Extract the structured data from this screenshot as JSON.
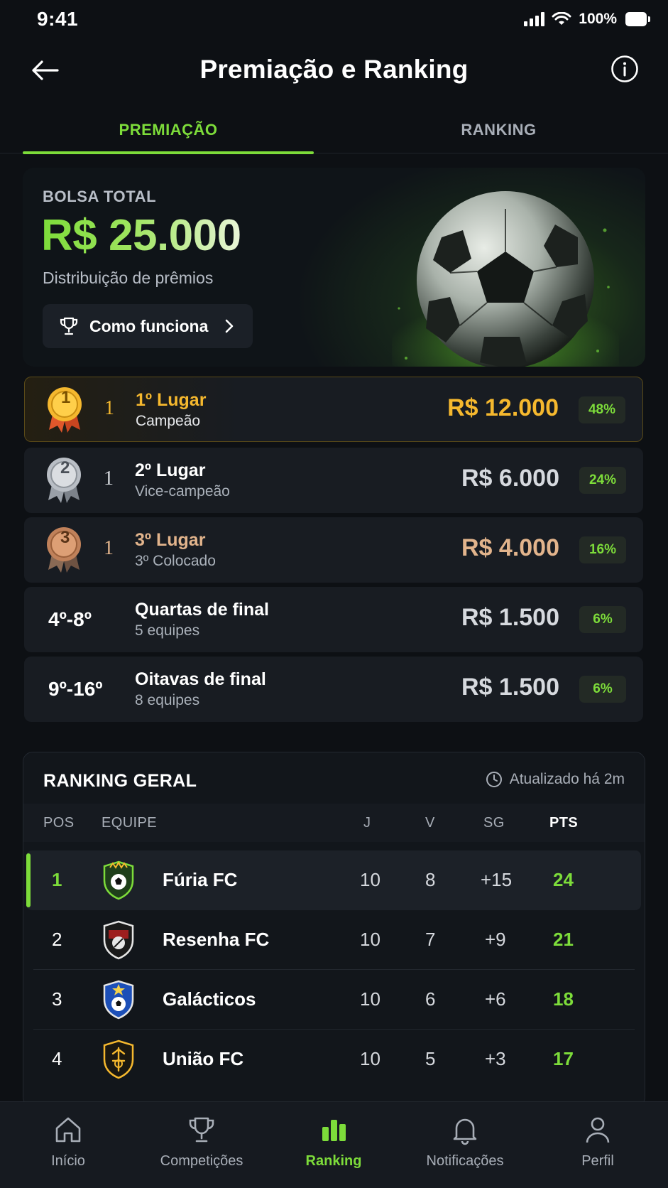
{
  "status_bar": {
    "time": "9:41",
    "battery": "100%"
  },
  "header": {
    "title": "Premiação e Ranking"
  },
  "tabs": [
    {
      "label": "PREMIAÇÃO"
    },
    {
      "label": "RANKING"
    }
  ],
  "hero": {
    "label": "BOLSA TOTAL",
    "amount": "R$ 25.000",
    "subtitle": "Distribuição de prêmios",
    "button_label": "Como funciona"
  },
  "prizes": [
    {
      "medal": "1",
      "side": "1",
      "name": "1º Lugar",
      "desc": "Campeão",
      "amount": "R$ 12.000",
      "pct": "48%",
      "color": "#f5b82e"
    },
    {
      "medal": "2",
      "side": "1",
      "name": "2º Lugar",
      "desc": "Vice-campeão",
      "amount": "R$ 6.000",
      "pct": "24%",
      "color": "#d6d9de"
    },
    {
      "medal": "3",
      "side": "1",
      "name": "3º Lugar",
      "desc": "3º Colocado",
      "amount": "R$ 4.000",
      "pct": "16%",
      "color": "#e2b48c"
    },
    {
      "range": "4º-8º",
      "name": "Quartas de final",
      "desc": "5 equipes",
      "amount": "R$ 1.500",
      "pct": "6%",
      "color": "#d6d9de"
    },
    {
      "range": "9º-16º",
      "name": "Oitavas de final",
      "desc": "8 equipes",
      "amount": "R$ 1.500",
      "pct": "6%",
      "color": "#d6d9de"
    }
  ],
  "ranking": {
    "title": "RANKING GERAL",
    "updated": "Atualizado há 2m",
    "columns": {
      "pos": "POS",
      "team": "EQUIPE",
      "j": "J",
      "v": "V",
      "sg": "SG",
      "pts": "PTS"
    },
    "rows": [
      {
        "pos": "1",
        "team": "Fúria FC",
        "j": "10",
        "v": "8",
        "sg": "+15",
        "pts": "24"
      },
      {
        "pos": "2",
        "team": "Resenha FC",
        "j": "10",
        "v": "7",
        "sg": "+9",
        "pts": "21"
      },
      {
        "pos": "3",
        "team": "Galácticos",
        "j": "10",
        "v": "6",
        "sg": "+6",
        "pts": "18"
      },
      {
        "pos": "4",
        "team": "União FC",
        "j": "10",
        "v": "5",
        "sg": "+3",
        "pts": "17"
      }
    ]
  },
  "nav": [
    {
      "label": "Início",
      "icon": "home-icon"
    },
    {
      "label": "Competições",
      "icon": "trophy-icon"
    },
    {
      "label": "Ranking",
      "icon": "bar-chart-icon"
    },
    {
      "label": "Notificações",
      "icon": "bell-icon"
    },
    {
      "label": "Perfil",
      "icon": "user-icon"
    }
  ],
  "colors": {
    "accent": "#7ddc3a",
    "gold": "#f5b82e",
    "silver": "#d6d9de",
    "bronze": "#e2b48c",
    "background": "#0d1014"
  }
}
